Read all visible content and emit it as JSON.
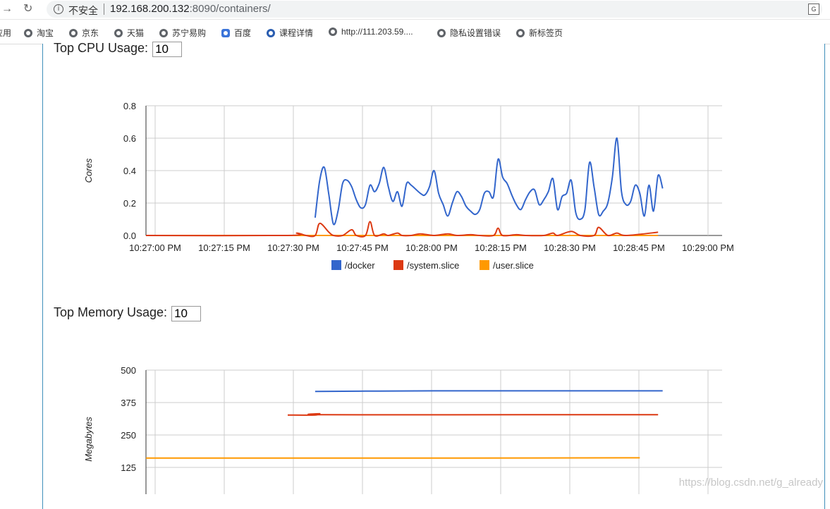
{
  "browser": {
    "insecure_label": "不安全",
    "url_host": "192.168.200.132",
    "url_rest": ":8090/containers/",
    "bookmarks": [
      "应用",
      "淘宝",
      "京东",
      "天猫",
      "苏宁易购",
      "百度",
      "课程详情",
      "http://111.203.59....",
      "隐私设置错误",
      "新标签页"
    ]
  },
  "cpu_section": {
    "label": "Top CPU Usage:",
    "value": "10"
  },
  "memory_section": {
    "label": "Top Memory Usage:",
    "value": "10"
  },
  "watermark": "https://blog.csdn.net/g_already",
  "colors": {
    "docker": "#3366cc",
    "system": "#dc3912",
    "user": "#ff9900"
  },
  "chart_data": [
    {
      "type": "line",
      "ylabel": "Cores",
      "ylim": [
        0,
        0.8
      ],
      "yticks": [
        "0.8",
        "0.6",
        "0.4",
        "0.2",
        "0.0"
      ],
      "xlim": [
        "10:26:57",
        "10:29:03"
      ],
      "xticks": [
        "10:27:00 PM",
        "10:27:15 PM",
        "10:27:30 PM",
        "10:27:45 PM",
        "10:28:00 PM",
        "10:28:15 PM",
        "10:28:30 PM",
        "10:28:45 PM",
        "10:29:00 PM"
      ],
      "legend": "bottom",
      "series": [
        {
          "name": "/docker",
          "color": "#3366cc",
          "points": [
            [
              "10:27:34",
              0.11
            ],
            [
              "10:27:35",
              0.34
            ],
            [
              "10:27:36",
              0.42
            ],
            [
              "10:27:37",
              0.25
            ],
            [
              "10:27:38",
              0.07
            ],
            [
              "10:27:39",
              0.15
            ],
            [
              "10:27:40",
              0.32
            ],
            [
              "10:27:41",
              0.34
            ],
            [
              "10:27:42",
              0.3
            ],
            [
              "10:27:43",
              0.22
            ],
            [
              "10:27:44",
              0.17
            ],
            [
              "10:27:45",
              0.19
            ],
            [
              "10:27:46",
              0.31
            ],
            [
              "10:27:47",
              0.27
            ],
            [
              "10:27:48",
              0.32
            ],
            [
              "10:27:49",
              0.42
            ],
            [
              "10:27:50",
              0.3
            ],
            [
              "10:27:51",
              0.21
            ],
            [
              "10:27:52",
              0.27
            ],
            [
              "10:27:53",
              0.18
            ],
            [
              "10:27:54",
              0.32
            ],
            [
              "10:27:55",
              0.31
            ],
            [
              "10:27:57",
              0.26
            ],
            [
              "10:27:58",
              0.25
            ],
            [
              "10:27:59",
              0.3
            ],
            [
              "10:28:00",
              0.4
            ],
            [
              "10:28:01",
              0.26
            ],
            [
              "10:28:02",
              0.19
            ],
            [
              "10:28:03",
              0.12
            ],
            [
              "10:28:04",
              0.2
            ],
            [
              "10:28:05",
              0.27
            ],
            [
              "10:28:06",
              0.24
            ],
            [
              "10:28:07",
              0.18
            ],
            [
              "10:28:08",
              0.15
            ],
            [
              "10:28:09",
              0.13
            ],
            [
              "10:28:10",
              0.16
            ],
            [
              "10:28:11",
              0.26
            ],
            [
              "10:28:12",
              0.27
            ],
            [
              "10:28:13",
              0.24
            ],
            [
              "10:28:14",
              0.47
            ],
            [
              "10:28:15",
              0.36
            ],
            [
              "10:28:16",
              0.32
            ],
            [
              "10:28:17",
              0.25
            ],
            [
              "10:28:18",
              0.19
            ],
            [
              "10:28:19",
              0.16
            ],
            [
              "10:28:20",
              0.22
            ],
            [
              "10:28:21",
              0.27
            ],
            [
              "10:28:22",
              0.28
            ],
            [
              "10:28:23",
              0.19
            ],
            [
              "10:28:24",
              0.22
            ],
            [
              "10:28:25",
              0.27
            ],
            [
              "10:28:26",
              0.35
            ],
            [
              "10:28:27",
              0.16
            ],
            [
              "10:28:28",
              0.24
            ],
            [
              "10:28:29",
              0.26
            ],
            [
              "10:28:30",
              0.34
            ],
            [
              "10:28:31",
              0.14
            ],
            [
              "10:28:32",
              0.1
            ],
            [
              "10:28:33",
              0.16
            ],
            [
              "10:28:34",
              0.45
            ],
            [
              "10:28:35",
              0.3
            ],
            [
              "10:28:36",
              0.13
            ],
            [
              "10:28:37",
              0.15
            ],
            [
              "10:28:38",
              0.2
            ],
            [
              "10:28:39",
              0.36
            ],
            [
              "10:28:40",
              0.6
            ],
            [
              "10:28:41",
              0.27
            ],
            [
              "10:28:42",
              0.19
            ],
            [
              "10:28:43",
              0.21
            ],
            [
              "10:28:44",
              0.31
            ],
            [
              "10:28:45",
              0.26
            ],
            [
              "10:28:46",
              0.12
            ],
            [
              "10:28:47",
              0.31
            ],
            [
              "10:28:48",
              0.15
            ],
            [
              "10:28:49",
              0.37
            ],
            [
              "10:28:50",
              0.29
            ]
          ]
        },
        {
          "name": "/system.slice",
          "color": "#dc3912",
          "points": [
            [
              "10:26:57",
              0
            ],
            [
              "10:27:28",
              0
            ],
            [
              "10:27:30",
              0.015
            ],
            [
              "10:27:32",
              0
            ],
            [
              "10:27:34",
              0
            ],
            [
              "10:27:35",
              0.075
            ],
            [
              "10:27:37",
              0.02
            ],
            [
              "10:27:38",
              0
            ],
            [
              "10:27:40",
              0
            ],
            [
              "10:27:42",
              0.035
            ],
            [
              "10:27:43",
              0
            ],
            [
              "10:27:45",
              0
            ],
            [
              "10:27:46",
              0.085
            ],
            [
              "10:27:47",
              0
            ],
            [
              "10:27:49",
              0.01
            ],
            [
              "10:27:50",
              0
            ],
            [
              "10:27:52",
              0.015
            ],
            [
              "10:27:53",
              0
            ],
            [
              "10:27:55",
              0
            ],
            [
              "10:27:57",
              0.01
            ],
            [
              "10:28:00",
              0
            ],
            [
              "10:28:03",
              0.01
            ],
            [
              "10:28:05",
              0
            ],
            [
              "10:28:08",
              0.005
            ],
            [
              "10:28:10",
              0
            ],
            [
              "10:28:13",
              0
            ],
            [
              "10:28:14",
              0.045
            ],
            [
              "10:28:15",
              0
            ],
            [
              "10:28:18",
              0.005
            ],
            [
              "10:28:20",
              0
            ],
            [
              "10:28:24",
              0
            ],
            [
              "10:28:26",
              0.015
            ],
            [
              "10:28:27",
              0
            ],
            [
              "10:28:30",
              0.025
            ],
            [
              "10:28:32",
              0
            ],
            [
              "10:28:35",
              0
            ],
            [
              "10:28:36",
              0.05
            ],
            [
              "10:28:38",
              0
            ],
            [
              "10:28:40",
              0.015
            ],
            [
              "10:28:42",
              0
            ],
            [
              "10:28:49",
              0.02
            ]
          ]
        },
        {
          "name": "/user.slice",
          "color": "#ff9900",
          "points": [
            [
              "10:26:57",
              0
            ],
            [
              "10:28:49",
              0
            ]
          ]
        }
      ]
    },
    {
      "type": "line",
      "ylabel": "Megabytes",
      "ylim": [
        0,
        500
      ],
      "yticks": [
        "500",
        "375",
        "250",
        "125"
      ],
      "xlim": [
        "10:26:57",
        "10:29:03"
      ],
      "series": [
        {
          "name": "/docker",
          "color": "#3366cc",
          "points": [
            [
              "10:27:34",
              418
            ],
            [
              "10:27:45",
              419
            ],
            [
              "10:28:00",
              420
            ],
            [
              "10:28:50",
              420
            ]
          ]
        },
        {
          "name": "/system.slice",
          "color": "#dc3912",
          "points": [
            [
              "10:27:28",
              327
            ],
            [
              "10:27:34",
              327
            ],
            [
              "10:27:35",
              332
            ],
            [
              "10:27:36",
              328
            ],
            [
              "10:28:20",
              328
            ],
            [
              "10:28:49",
              328
            ]
          ]
        },
        {
          "name": "/user.slice",
          "color": "#ff9900",
          "points": [
            [
              "10:26:57",
              161
            ],
            [
              "10:28:00",
              161
            ],
            [
              "10:28:45",
              162
            ]
          ]
        }
      ]
    }
  ]
}
